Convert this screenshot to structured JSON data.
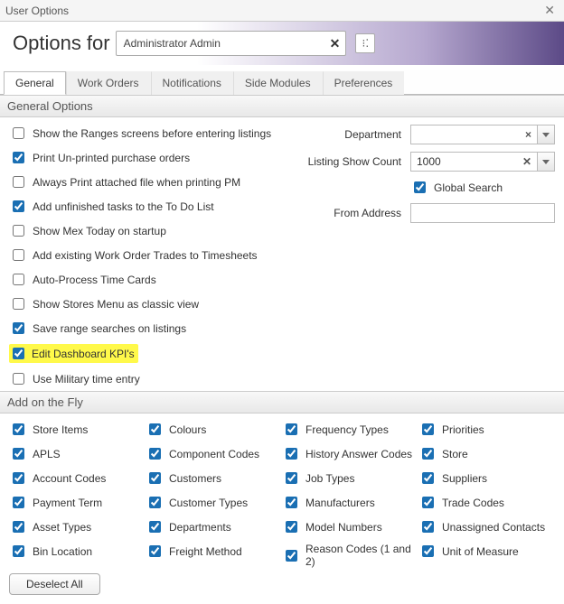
{
  "window": {
    "title": "User Options"
  },
  "header": {
    "prefix": "Options for",
    "user_value": "Administrator Admin"
  },
  "tabs": [
    {
      "label": "General",
      "active": true
    },
    {
      "label": "Work Orders",
      "active": false
    },
    {
      "label": "Notifications",
      "active": false
    },
    {
      "label": "Side Modules",
      "active": false
    },
    {
      "label": "Preferences",
      "active": false
    }
  ],
  "sections": {
    "general": {
      "title": "General Options",
      "checks": [
        {
          "label": "Show the Ranges screens before entering listings",
          "checked": false,
          "highlight": false
        },
        {
          "label": "Print Un-printed purchase orders",
          "checked": true,
          "highlight": false
        },
        {
          "label": "Always Print attached file when printing PM",
          "checked": false,
          "highlight": false
        },
        {
          "label": "Add unfinished tasks to the To Do List",
          "checked": true,
          "highlight": false
        },
        {
          "label": "Show Mex Today on startup",
          "checked": false,
          "highlight": false
        },
        {
          "label": "Add existing Work Order Trades to Timesheets",
          "checked": false,
          "highlight": false
        },
        {
          "label": "Auto-Process Time Cards",
          "checked": false,
          "highlight": false
        },
        {
          "label": "Show Stores Menu as classic view",
          "checked": false,
          "highlight": false
        },
        {
          "label": "Save range searches on listings",
          "checked": true,
          "highlight": false
        },
        {
          "label": "Edit Dashboard KPI's",
          "checked": true,
          "highlight": true
        },
        {
          "label": "Use Military time entry",
          "checked": false,
          "highlight": false
        }
      ],
      "fields": {
        "department": {
          "label": "Department",
          "value": ""
        },
        "listing_show_count": {
          "label": "Listing Show Count",
          "value": "1000"
        },
        "global_search": {
          "label": "Global Search",
          "checked": true
        },
        "from_address": {
          "label": "From Address",
          "value": ""
        }
      }
    },
    "addonfly": {
      "title": "Add on the Fly",
      "cols": [
        [
          {
            "label": "Store Items",
            "checked": true
          },
          {
            "label": "APLS",
            "checked": true
          },
          {
            "label": "Account Codes",
            "checked": true
          },
          {
            "label": "Payment Term",
            "checked": true
          },
          {
            "label": "Asset Types",
            "checked": true
          },
          {
            "label": "Bin Location",
            "checked": true
          }
        ],
        [
          {
            "label": "Colours",
            "checked": true
          },
          {
            "label": "Component Codes",
            "checked": true
          },
          {
            "label": "Customers",
            "checked": true
          },
          {
            "label": "Customer Types",
            "checked": true
          },
          {
            "label": "Departments",
            "checked": true
          },
          {
            "label": "Freight Method",
            "checked": true
          }
        ],
        [
          {
            "label": "Frequency Types",
            "checked": true
          },
          {
            "label": "History Answer Codes",
            "checked": true
          },
          {
            "label": "Job Types",
            "checked": true
          },
          {
            "label": "Manufacturers",
            "checked": true
          },
          {
            "label": "Model Numbers",
            "checked": true
          },
          {
            "label": "Reason Codes (1 and 2)",
            "checked": true
          }
        ],
        [
          {
            "label": "Priorities",
            "checked": true
          },
          {
            "label": "Store",
            "checked": true
          },
          {
            "label": "Suppliers",
            "checked": true
          },
          {
            "label": "Trade Codes",
            "checked": true
          },
          {
            "label": "Unassigned Contacts",
            "checked": true
          },
          {
            "label": "Unit of Measure",
            "checked": true
          }
        ]
      ],
      "deselect_label": "Deselect All"
    }
  }
}
